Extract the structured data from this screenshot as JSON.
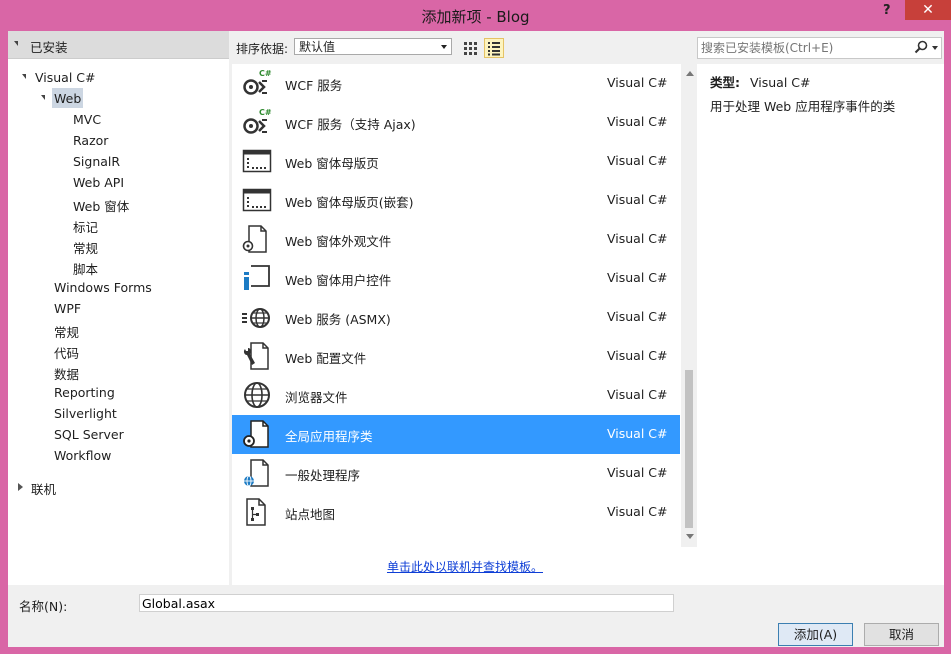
{
  "window": {
    "title": "添加新项 - Blog",
    "help_glyph": "?",
    "close_glyph": "✕"
  },
  "left_panel": {
    "header": "已安装",
    "tree": [
      {
        "label": "Visual C#",
        "level": 1,
        "expanded": true
      },
      {
        "label": "Web",
        "level": 2,
        "expanded": true,
        "selected": true
      },
      {
        "label": "MVC",
        "level": 3
      },
      {
        "label": "Razor",
        "level": 3
      },
      {
        "label": "SignalR",
        "level": 3
      },
      {
        "label": "Web API",
        "level": 3
      },
      {
        "label": "Web 窗体",
        "level": 3
      },
      {
        "label": "标记",
        "level": 3
      },
      {
        "label": "常规",
        "level": 3
      },
      {
        "label": "脚本",
        "level": 3
      },
      {
        "label": "Windows Forms",
        "level": 2
      },
      {
        "label": "WPF",
        "level": 2
      },
      {
        "label": "常规",
        "level": 2
      },
      {
        "label": "代码",
        "level": 2
      },
      {
        "label": "数据",
        "level": 2
      },
      {
        "label": "Reporting",
        "level": 2
      },
      {
        "label": "Silverlight",
        "level": 2
      },
      {
        "label": "SQL Server",
        "level": 2
      },
      {
        "label": "Workflow",
        "level": 2
      }
    ],
    "online_label": "联机"
  },
  "toolbar": {
    "sort_label": "排序依据:",
    "sort_value": "默认值",
    "view_modes": [
      "grid-view-icon",
      "list-view-icon"
    ],
    "active_view": "list-view-icon"
  },
  "search": {
    "placeholder": "搜索已安装模板(Ctrl+E)",
    "value": ""
  },
  "templates": [
    {
      "name": "WCF 服务",
      "lang": "Visual C#",
      "icon": "wcf-service-icon"
    },
    {
      "name": "WCF 服务（支持 Ajax)",
      "lang": "Visual C#",
      "icon": "wcf-ajax-service-icon"
    },
    {
      "name": "Web 窗体母版页",
      "lang": "Visual C#",
      "icon": "master-page-icon"
    },
    {
      "name": "Web 窗体母版页(嵌套)",
      "lang": "Visual C#",
      "icon": "nested-master-page-icon"
    },
    {
      "name": "Web 窗体外观文件",
      "lang": "Visual C#",
      "icon": "skin-file-icon"
    },
    {
      "name": "Web 窗体用户控件",
      "lang": "Visual C#",
      "icon": "user-control-icon"
    },
    {
      "name": "Web 服务 (ASMX)",
      "lang": "Visual C#",
      "icon": "web-service-icon"
    },
    {
      "name": "Web 配置文件",
      "lang": "Visual C#",
      "icon": "config-file-icon"
    },
    {
      "name": "浏览器文件",
      "lang": "Visual C#",
      "icon": "browser-file-icon"
    },
    {
      "name": "全局应用程序类",
      "lang": "Visual C#",
      "icon": "global-app-class-icon",
      "selected": true
    },
    {
      "name": "一般处理程序",
      "lang": "Visual C#",
      "icon": "generic-handler-icon"
    },
    {
      "name": "站点地图",
      "lang": "Visual C#",
      "icon": "site-map-icon"
    }
  ],
  "online_link": "单击此处以联机并查找模板。",
  "details": {
    "type_label": "类型:",
    "type_value": "Visual C#",
    "description": "用于处理 Web 应用程序事件的类"
  },
  "name_field": {
    "label": "名称(N):",
    "value": "Global.asax"
  },
  "buttons": {
    "add": "添加(A)",
    "cancel": "取消"
  },
  "colors": {
    "chrome": "#d966a6",
    "selection": "#3399ff",
    "link": "#0e3ed6"
  }
}
